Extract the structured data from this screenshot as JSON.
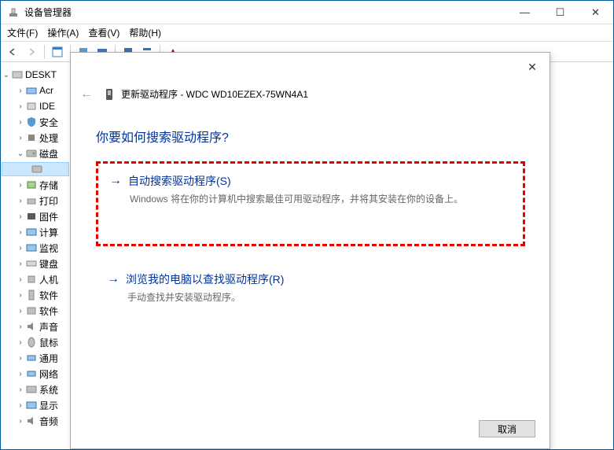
{
  "window": {
    "title": "设备管理器",
    "min": "—",
    "max": "☐",
    "close": "✕"
  },
  "menu": {
    "file": "文件(F)",
    "action": "操作(A)",
    "view": "查看(V)",
    "help": "帮助(H)"
  },
  "tree": {
    "root": "DESKT",
    "items": [
      {
        "label": "Acr"
      },
      {
        "label": "IDE"
      },
      {
        "label": "安全"
      },
      {
        "label": "处理"
      },
      {
        "label": "磁盘",
        "expanded": true,
        "child": ""
      },
      {
        "label": "存储"
      },
      {
        "label": "打印"
      },
      {
        "label": "固件"
      },
      {
        "label": "计算"
      },
      {
        "label": "监视"
      },
      {
        "label": "键盘"
      },
      {
        "label": "人机"
      },
      {
        "label": "软件"
      },
      {
        "label": "软件"
      },
      {
        "label": "声音"
      },
      {
        "label": "鼠标"
      },
      {
        "label": "通用"
      },
      {
        "label": "网络"
      },
      {
        "label": "系统"
      },
      {
        "label": "显示"
      },
      {
        "label": "音频"
      }
    ]
  },
  "dialog": {
    "close": "✕",
    "back": "←",
    "header": "更新驱动程序 - WDC WD10EZEX-75WN4A1",
    "question": "你要如何搜索驱动程序?",
    "option1_arrow": "→",
    "option1_title": "自动搜索驱动程序(S)",
    "option1_desc": "Windows 将在你的计算机中搜索最佳可用驱动程序，并将其安装在你的设备上。",
    "option2_arrow": "→",
    "option2_title": "浏览我的电脑以查找驱动程序(R)",
    "option2_desc": "手动查找并安装驱动程序。",
    "cancel": "取消"
  }
}
